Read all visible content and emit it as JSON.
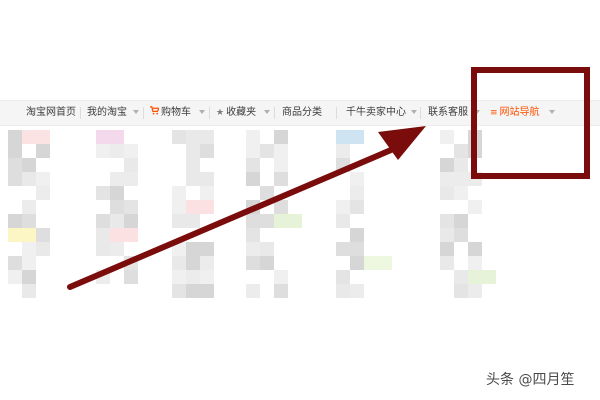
{
  "colors": {
    "accent": "#ff5000",
    "cart_icon": "#ff5000",
    "annotation": "#7a0c0c",
    "star_icon": "#8c8c8c"
  },
  "nav": {
    "items": [
      {
        "label": "淘宝网首页",
        "caret": false
      },
      {
        "label": "我的淘宝",
        "caret": true
      },
      {
        "label": "购物车",
        "caret": true,
        "icon": "cart-icon"
      },
      {
        "label": "收藏夹",
        "caret": true,
        "icon": "star-icon"
      },
      {
        "label": "商品分类",
        "caret": false
      },
      {
        "label": "千牛卖家中心",
        "caret": true
      },
      {
        "label": "联系客服",
        "caret": true
      },
      {
        "label": "网站导航",
        "caret": true,
        "icon": "menu-lines-icon",
        "highlighted": true
      }
    ]
  },
  "watermark": {
    "text": "头条 @四月笙"
  }
}
